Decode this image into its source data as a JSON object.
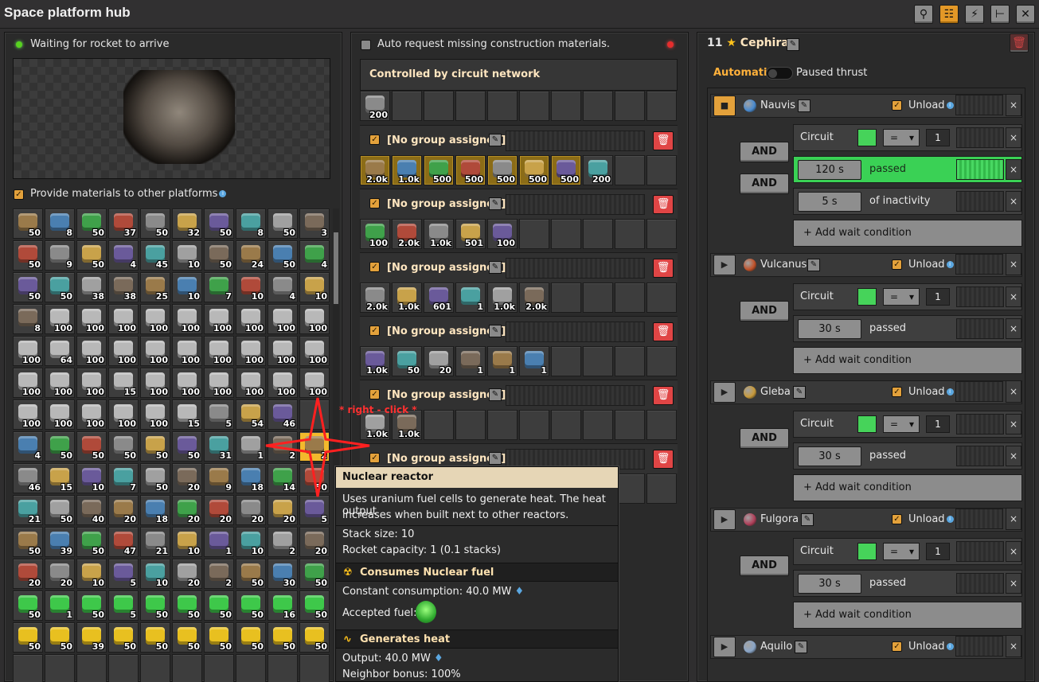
{
  "window": {
    "title": "Space platform hub"
  },
  "toolbar": {
    "buttons": [
      "search-icon",
      "network-icon",
      "lightning-icon",
      "pin-icon",
      "close-icon"
    ]
  },
  "left": {
    "status": "Waiting for rocket to arrive",
    "provide_label": "Provide materials to other platforms",
    "inventory_rows": [
      [
        "50",
        "8",
        "50",
        "37",
        "50",
        "32",
        "50",
        "8",
        "50",
        "3"
      ],
      [
        "50",
        "9",
        "50",
        "4",
        "45",
        "10",
        "50",
        "24",
        "50",
        "4"
      ],
      [
        "50",
        "50",
        "38",
        "38",
        "25",
        "10",
        "7",
        "10",
        "4",
        "10"
      ],
      [
        "8",
        "100",
        "100",
        "100",
        "100",
        "100",
        "100",
        "100",
        "100",
        "100"
      ],
      [
        "100",
        "64",
        "100",
        "100",
        "100",
        "100",
        "100",
        "100",
        "100",
        "100"
      ],
      [
        "100",
        "100",
        "100",
        "15",
        "100",
        "100",
        "100",
        "100",
        "100",
        "100"
      ],
      [
        "100",
        "100",
        "100",
        "100",
        "100",
        "15",
        "5",
        "54",
        "46",
        ""
      ],
      [
        "4",
        "50",
        "50",
        "50",
        "50",
        "50",
        "31",
        "1",
        "2",
        "2"
      ],
      [
        "46",
        "15",
        "10",
        "7",
        "50",
        "20",
        "9",
        "18",
        "14",
        "50"
      ],
      [
        "21",
        "50",
        "40",
        "20",
        "18",
        "20",
        "20",
        "20",
        "20",
        "5"
      ],
      [
        "50",
        "39",
        "50",
        "47",
        "21",
        "10",
        "1",
        "10",
        "2",
        "20"
      ],
      [
        "20",
        "20",
        "10",
        "5",
        "10",
        "20",
        "2",
        "50",
        "30",
        "50"
      ],
      [
        "50",
        "1",
        "50",
        "5",
        "50",
        "50",
        "50",
        "50",
        "16",
        "50"
      ],
      [
        "50",
        "50",
        "39",
        "50",
        "50",
        "50",
        "50",
        "50",
        "50",
        "50"
      ],
      [
        "",
        "",
        "",
        "",
        "",
        "",
        "",
        "",
        "",
        ""
      ]
    ]
  },
  "annotation": {
    "right_click": "* right - click *"
  },
  "middle": {
    "auto_request": "Auto request missing construction materials.",
    "circuit_header": "Controlled by circuit network",
    "circuit_slot": "200",
    "group_label": "[No group assigned]",
    "groups": [
      [
        "2.0k",
        "1.0k",
        "500",
        "500",
        "500",
        "500",
        "500",
        "200",
        ""
      ],
      [
        "100",
        "2.0k",
        "1.0k",
        "501",
        "100",
        "",
        "",
        "",
        ""
      ],
      [
        "2.0k",
        "1.0k",
        "601",
        "1",
        "1.0k",
        "2.0k",
        "",
        "",
        ""
      ],
      [
        "1.0k",
        "50",
        "20",
        "1",
        "1",
        "1",
        "",
        "",
        ""
      ],
      [
        "1.0k",
        "1.0k",
        "",
        "",
        "",
        "",
        "",
        "",
        ""
      ],
      [
        "",
        "",
        "",
        "",
        "",
        "",
        "",
        "",
        ""
      ]
    ]
  },
  "tooltip": {
    "title": "Nuclear reactor",
    "description_1": "Uses uranium fuel cells to generate heat. The heat output",
    "description_2": "increases when built next to other reactors.",
    "stack_size": "Stack size: 10",
    "rocket_capacity": "Rocket capacity: 1 (0.1 stacks)",
    "consumes_header": "Consumes Nuclear fuel",
    "consumption": "Constant consumption: 40.0 MW",
    "accepted_fuel": "Accepted fuel:",
    "generates_header": "Generates heat",
    "output": "Output: 40.0 MW",
    "neighbor": "Neighbor bonus: 100%"
  },
  "right": {
    "platform_count": "11",
    "platform_name": "Cephira",
    "mode": "Automatic",
    "paused_label": "Paused thrust",
    "unload_label": "Unload",
    "and_label": "AND",
    "circuit_label": "Circuit",
    "op": "=",
    "const": "1",
    "passed": "passed",
    "inactivity": "of inactivity",
    "add_wait": "+ Add wait condition",
    "stops": [
      {
        "name": "Nauvis",
        "color": "#4a8bd0",
        "time": "120 s",
        "inactivity_time": "5 s"
      },
      {
        "name": "Vulcanus",
        "color": "#c0522a",
        "time": "30 s"
      },
      {
        "name": "Gleba",
        "color": "#c89a3a",
        "time": "30 s"
      },
      {
        "name": "Fulgora",
        "color": "#b0405a",
        "time": "30 s"
      },
      {
        "name": "Aquilo",
        "color": "#8aa6c8"
      }
    ]
  }
}
